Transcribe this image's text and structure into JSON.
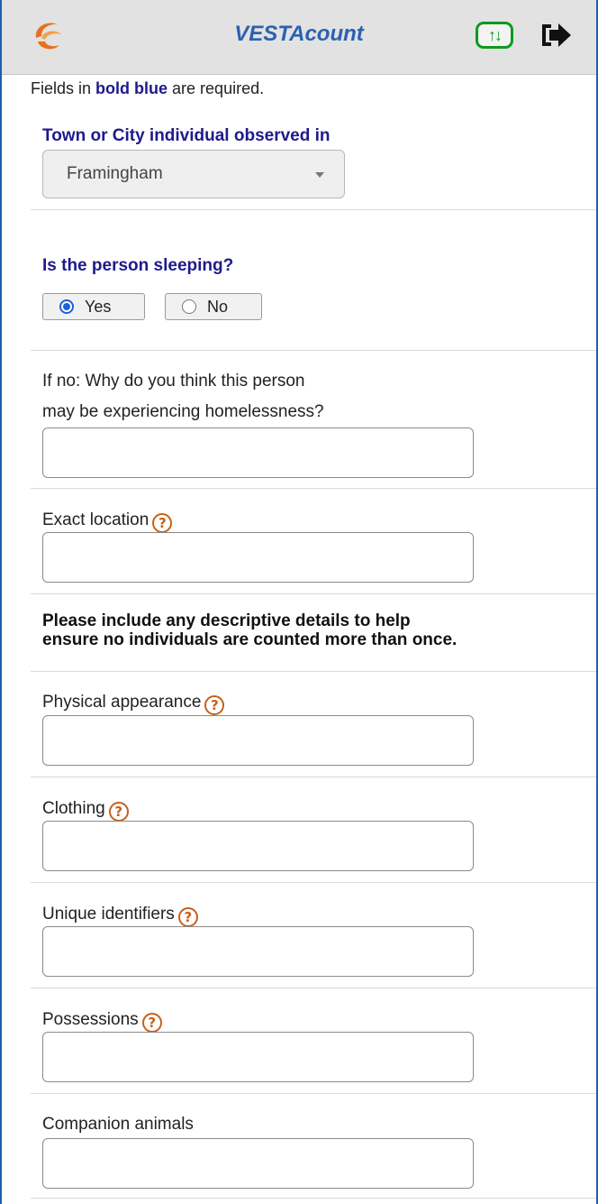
{
  "header": {
    "title": "VESTAcount",
    "sync_glyph": "↑↓",
    "logo_icon": "vesta-logo-icon",
    "sync_icon": "sync-arrows-icon",
    "logout_icon": "logout-icon",
    "colors": {
      "header_bg": "#e2e2e2",
      "title": "#2a62b0",
      "sync": "#0d9a1c"
    }
  },
  "form": {
    "required_note": {
      "prefix": "Fields in ",
      "emphasis": "bold blue",
      "suffix": " are required."
    },
    "town": {
      "label": "Town or City individual observed in",
      "value": "Framingham"
    },
    "sleeping": {
      "label": "Is the person sleeping?",
      "options": [
        {
          "label": "Yes",
          "selected": true
        },
        {
          "label": "No",
          "selected": false
        }
      ]
    },
    "why_homeless": {
      "label_line1": "If no: Why do you think this person",
      "label_line2": "may be experiencing homelessness?",
      "value": ""
    },
    "exact_location": {
      "label": "Exact location",
      "value": ""
    },
    "descriptive_note": {
      "line1": "Please include any descriptive details to help",
      "line2": "ensure no individuals are counted more than once."
    },
    "physical_appearance": {
      "label": "Physical appearance",
      "value": ""
    },
    "clothing": {
      "label": "Clothing",
      "value": ""
    },
    "unique_identifiers": {
      "label": "Unique identifiers",
      "value": ""
    },
    "possessions": {
      "label": "Possessions",
      "value": ""
    },
    "companion_animals": {
      "label": "Companion animals",
      "value": ""
    },
    "help_glyph": "?",
    "colors": {
      "required": "#1e1a8c",
      "help": "#c8601a",
      "radio": "#1a62d6"
    }
  }
}
